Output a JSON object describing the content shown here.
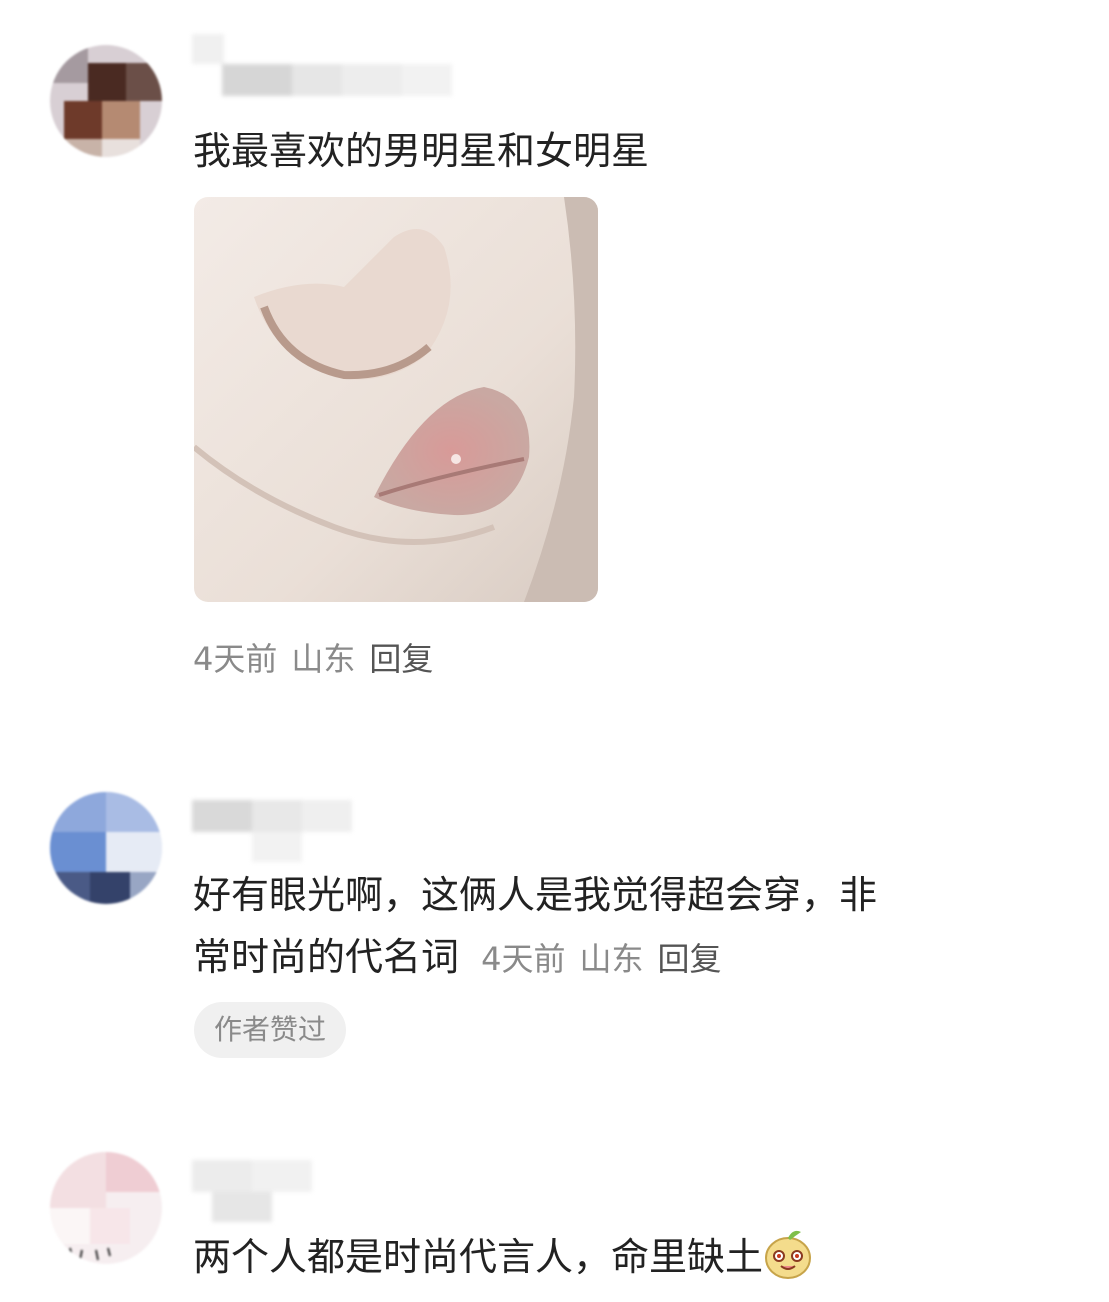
{
  "comments": [
    {
      "text": "我最喜欢的男明星和女明星",
      "meta": {
        "time": "4天前",
        "location": "山东",
        "reply": "回复"
      }
    },
    {
      "text_line1": "好有眼光啊，这俩人是我觉得超会穿，非",
      "text_line2": "常时尚的代名词",
      "meta": {
        "time": "4天前",
        "location": "山东",
        "reply": "回复"
      },
      "liked_badge": "作者赞过"
    },
    {
      "text": "两个人都是时尚代言人，命里缺土",
      "emoji": "smiling-bean-emoji-icon"
    }
  ],
  "colors": {
    "text": "#222222",
    "meta": "#8a8a8a",
    "badge_bg": "#f0f0f0"
  }
}
